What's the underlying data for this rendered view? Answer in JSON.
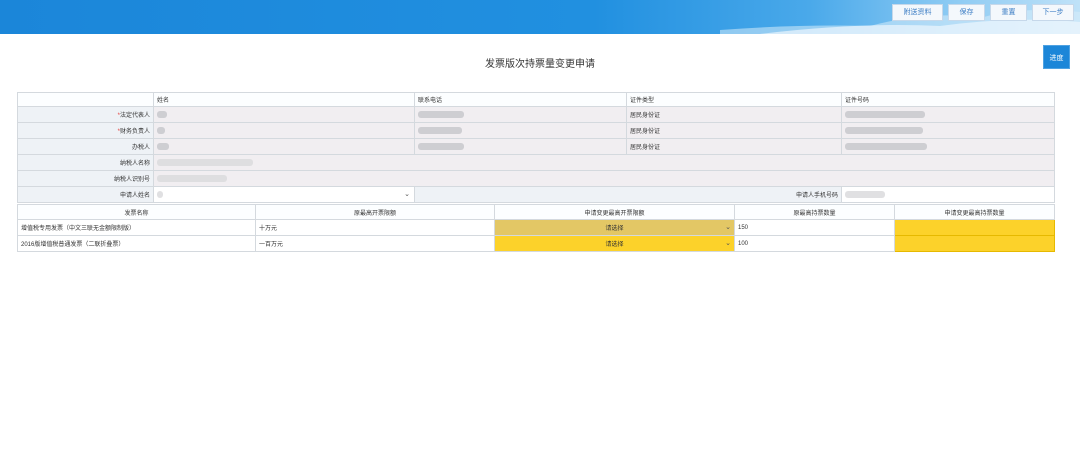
{
  "header": {
    "buttons": [
      {
        "label": "附送资料"
      },
      {
        "label": "保存"
      },
      {
        "label": "重置"
      },
      {
        "label": "下一步"
      }
    ]
  },
  "page_title": "发票版次持票量变更申请",
  "progress_button": "进度",
  "people_table": {
    "headers": [
      "姓名",
      "联系电话",
      "证件类型",
      "证件号码"
    ],
    "rows": [
      {
        "label": "法定代表人",
        "required": "*",
        "id_type": "居民身份证"
      },
      {
        "label": "财务负责人",
        "required": "*",
        "id_type": "居民身份证"
      },
      {
        "label": "办税人",
        "required": "",
        "id_type": "居民身份证"
      }
    ],
    "taxpayer_name_label": "纳税人名称",
    "taxpayer_id_label": "纳税人识别号",
    "applicant_name_label": "申请人姓名",
    "applicant_phone_label": "申请人手机号码"
  },
  "invoice_table": {
    "headers": [
      "发票名称",
      "原最高开票限额",
      "申请变更最高开票限额",
      "原最高持票数量",
      "申请变更最高持票数量"
    ],
    "rows": [
      {
        "name": "增值税专用发票（中文三联无金额限制版）",
        "limit": "十万元",
        "select": "请选择",
        "quantity": "150"
      },
      {
        "name": "2016版增值税普通发票（二联折叠票）",
        "limit": "一百万元",
        "select": "请选择",
        "quantity": "100"
      }
    ]
  },
  "colors": {
    "accent": "#1c86d8",
    "highlight": "#fcd22a"
  }
}
